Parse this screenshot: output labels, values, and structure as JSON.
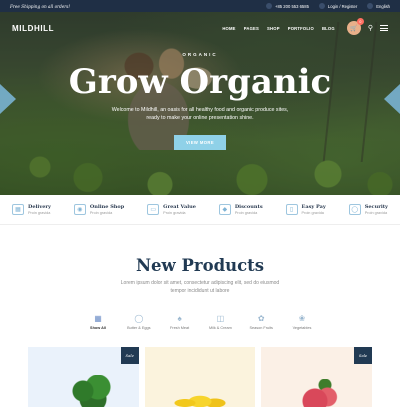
{
  "topbar": {
    "promo": "Free Shipping on all orders!",
    "phone": "+85 200 553 6585",
    "login": "Login / Register",
    "language": "English"
  },
  "nav": {
    "logo": "MILDHILL",
    "menu": [
      "HOME",
      "PAGES",
      "SHOP",
      "PORTFOLIO",
      "BLOG"
    ],
    "cart_count": "0"
  },
  "hero": {
    "eyebrow": "ORGANIC",
    "headline": "Grow Organic",
    "subtitle": "Welcome to Mildhill, an oasis for all healthy food and organic produce sites, ready to make your online presentation shine.",
    "button": "VIEW MORE"
  },
  "features": [
    {
      "title": "Delivery",
      "sub": "Proin gravida",
      "icon": "truck-icon"
    },
    {
      "title": "Online Shop",
      "sub": "Proin gravida",
      "icon": "headset-icon"
    },
    {
      "title": "Great Value",
      "sub": "Proin gravida",
      "icon": "box-icon"
    },
    {
      "title": "Discounts",
      "sub": "Proin gravida",
      "icon": "tag-icon"
    },
    {
      "title": "Easy Pay",
      "sub": "Proin gravida",
      "icon": "mobile-icon"
    },
    {
      "title": "Security",
      "sub": "Proin gravida",
      "icon": "shield-icon"
    }
  ],
  "products": {
    "title": "New Products",
    "description": "Lorem ipsum dolor sit amet, consectetur adipiscing elit, sed do eiusmod tempor incididunt ut labore",
    "categories": [
      "Show All",
      "Butter & Eggs",
      "Fresh Meat",
      "Milk & Cream",
      "Season Fruits",
      "Vegetables"
    ],
    "badge": "Sale"
  }
}
